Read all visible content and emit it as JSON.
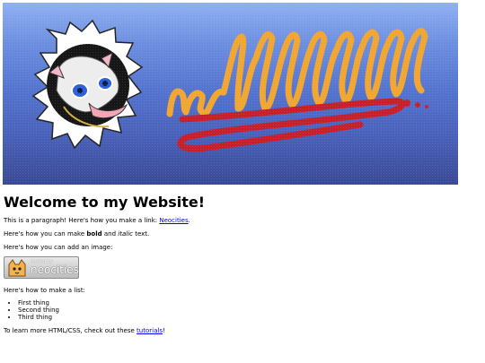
{
  "banner": {
    "image_alt": "Opossum illustration with handwritten nefffffffffff lettering"
  },
  "page": {
    "heading": "Welcome to my Website!",
    "para1_text": "This is a paragraph! Here's how you make a link: ",
    "para1_link": "Neocities",
    "para1_end": ".",
    "para2_a": "Here's how you can make ",
    "para2_bold": "bold",
    "para2_b": " and ",
    "para2_italic": "italic",
    "para2_c": " text.",
    "para3_text": "Here's how you can add an image:",
    "badge_hosted": "hosted by",
    "badge_brand": "neocities",
    "para4_text": "Here's how to make a list:",
    "list_items": [
      "First thing",
      "Second thing",
      "Third thing"
    ],
    "para5_text": "To learn more HTML/CSS, check out these ",
    "para5_link": "tutorials",
    "para5_end": "!"
  },
  "colors": {
    "link": "#0000ee",
    "banner_top": "#8fb0f2",
    "banner_bottom": "#3a4a94",
    "lettering": "#f2a632",
    "swoosh": "#c8202a"
  }
}
